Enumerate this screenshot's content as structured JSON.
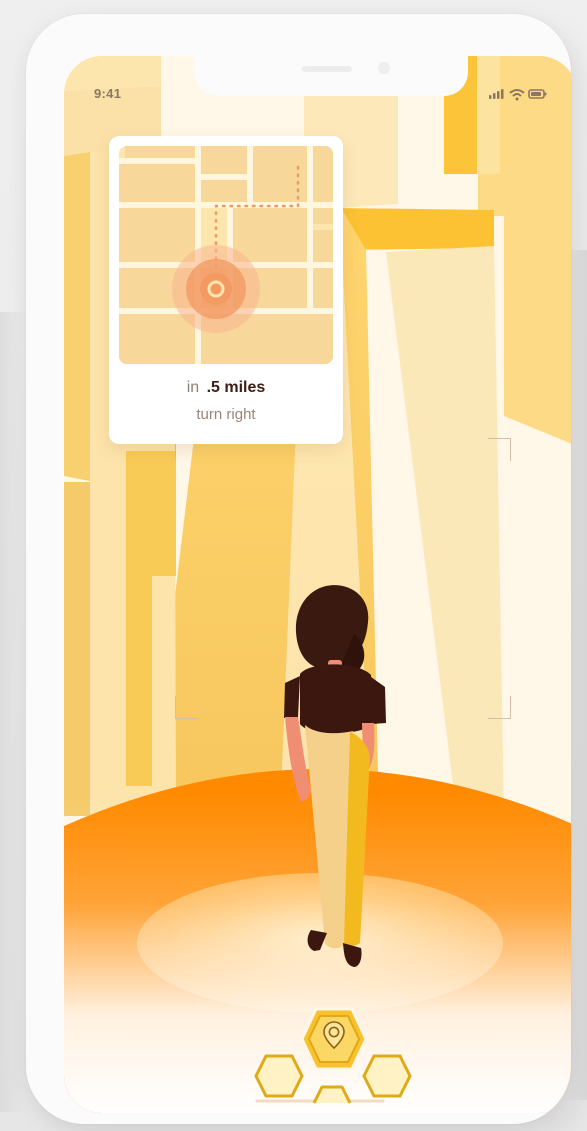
{
  "status_bar": {
    "time": "9:41",
    "signal_icon": "signal-icon",
    "wifi_icon": "wifi-icon",
    "battery_icon": "battery-icon"
  },
  "navigation_card": {
    "prefix": "in",
    "distance": ".5 miles",
    "direction": "turn right",
    "map_icon": "map-icon",
    "pin_icon": "location-pin-icon"
  },
  "bottom_navigation": {
    "items": [
      {
        "icon": "map-pin-icon",
        "state": "active"
      },
      {
        "icon": "hexagon-icon",
        "state": "inactive"
      },
      {
        "icon": "hexagon-icon",
        "state": "inactive"
      },
      {
        "icon": "hexagon-icon",
        "state": "inactive"
      }
    ]
  },
  "colors": {
    "background": "#ECECEC",
    "phone_frame": "#FBFBFB",
    "sky": "#FFF7E7",
    "orange": "#F7931E",
    "deep_orange": "#FF8A00",
    "light_yellow": "#FDE6AD",
    "gold": "#F7C229",
    "dark_text": "#3F1C14",
    "muted_text": "#8E7468",
    "hair": "#3A1910",
    "shirt": "#3C1710",
    "skin": "#F08E74",
    "pants_light": "#F4D08A",
    "pants_gold": "#F3BA1F"
  }
}
